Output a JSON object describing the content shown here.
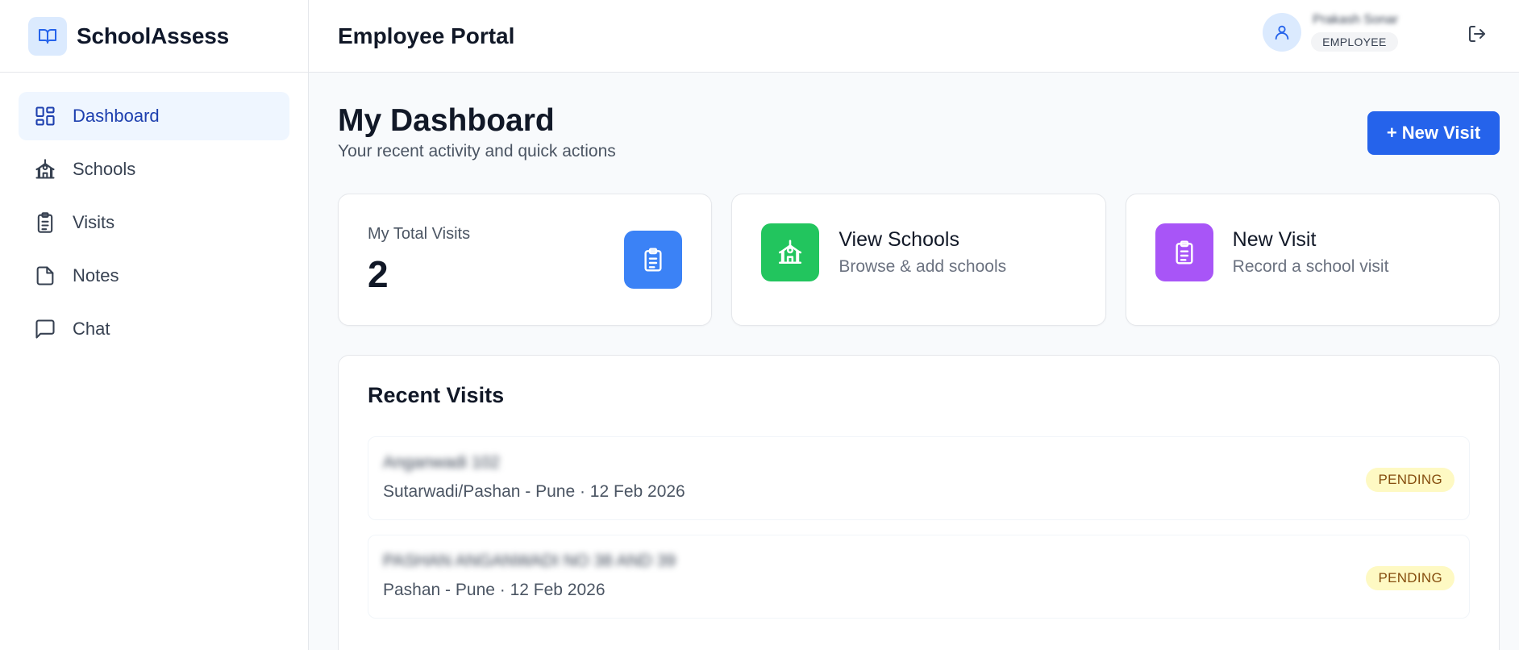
{
  "app": {
    "name": "SchoolAssess",
    "portal_title": "Employee Portal"
  },
  "sidebar": {
    "items": [
      {
        "label": "Dashboard",
        "icon": "dashboard-icon",
        "active": true
      },
      {
        "label": "Schools",
        "icon": "school-icon",
        "active": false
      },
      {
        "label": "Visits",
        "icon": "clipboard-icon",
        "active": false
      },
      {
        "label": "Notes",
        "icon": "file-icon",
        "active": false
      },
      {
        "label": "Chat",
        "icon": "chat-icon",
        "active": false
      }
    ]
  },
  "user": {
    "name": "Prakash Sonar",
    "role": "EMPLOYEE"
  },
  "dashboard": {
    "title": "My Dashboard",
    "subtitle": "Your recent activity and quick actions",
    "new_visit_label": "+ New Visit"
  },
  "cards": {
    "total_visits": {
      "label": "My Total Visits",
      "value": "2"
    },
    "view_schools": {
      "title": "View Schools",
      "subtitle": "Browse & add schools"
    },
    "new_visit": {
      "title": "New Visit",
      "subtitle": "Record a school visit"
    }
  },
  "recent_visits": {
    "title": "Recent Visits",
    "items": [
      {
        "name": "Anganwadi 102",
        "meta": "Sutarwadi/Pashan - Pune · 12 Feb 2026",
        "status": "PENDING"
      },
      {
        "name": "PASHAN ANGANWADI NO 38 AND 39",
        "meta": "Pashan - Pune · 12 Feb 2026",
        "status": "PENDING"
      }
    ]
  },
  "colors": {
    "primary": "#2563eb",
    "stat_icon_bg": "#3b82f6",
    "schools_icon_bg": "#22c55e",
    "new_visit_icon_bg": "#a855f7",
    "pending_bg": "#fef9c3",
    "pending_text": "#854d0e"
  }
}
